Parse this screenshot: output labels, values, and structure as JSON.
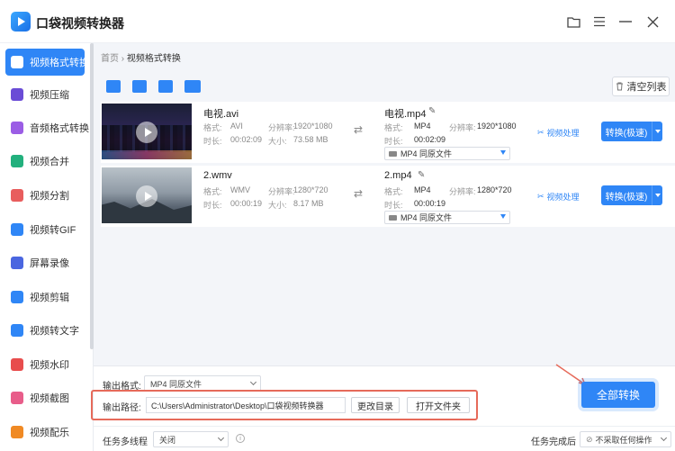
{
  "app": {
    "title": "口袋视频转换器"
  },
  "sidebar": {
    "items": [
      {
        "label": "视频格式转换",
        "color": "#ffffff"
      },
      {
        "label": "视频压缩",
        "color": "#6a4cd6"
      },
      {
        "label": "音频格式转换",
        "color": "#9b5de5"
      },
      {
        "label": "视频合并",
        "color": "#22b07d"
      },
      {
        "label": "视频分割",
        "color": "#e85d5d"
      },
      {
        "label": "视频转GIF",
        "color": "#2f86f6"
      },
      {
        "label": "屏幕录像",
        "color": "#4a66e0"
      },
      {
        "label": "视频剪辑",
        "color": "#2f86f6"
      },
      {
        "label": "视频转文字",
        "color": "#2f86f6"
      },
      {
        "label": "视频水印",
        "color": "#e84d4d"
      },
      {
        "label": "视频截图",
        "color": "#e85d8a"
      },
      {
        "label": "视频配乐",
        "color": "#f08a24"
      }
    ]
  },
  "breadcrumb": {
    "home": "首页",
    "sep": "›",
    "current": "视频格式转换"
  },
  "toolbar": {
    "clear_label": "清空列表"
  },
  "files": [
    {
      "src_name": "电视.avi",
      "fmt_label": "格式:",
      "src_fmt": "AVI",
      "res_label": "分辨率:",
      "src_res": "1920*1080",
      "dur_label": "时长:",
      "src_dur": "00:02:09",
      "size_label": "大小:",
      "src_size": "73.58 MB",
      "out_name": "电视.mp4",
      "out_fmt": "MP4",
      "out_res": "1920*1080",
      "out_dur": "00:02:09",
      "out_select": "MP4  同原文件",
      "proc_label": "视频处理",
      "conv_label": "转换(极速)"
    },
    {
      "src_name": "2.wmv",
      "fmt_label": "格式:",
      "src_fmt": "WMV",
      "res_label": "分辨率:",
      "src_res": "1280*720",
      "dur_label": "时长:",
      "src_dur": "00:00:19",
      "size_label": "大小:",
      "src_size": "8.17 MB",
      "out_name": "2.mp4",
      "out_fmt": "MP4",
      "out_res": "1280*720",
      "out_dur": "00:00:19",
      "out_select": "MP4  同原文件",
      "proc_label": "视频处理",
      "conv_label": "转换(极速)"
    }
  ],
  "bottom": {
    "out_format_label": "输出格式:",
    "out_format_value": "MP4  同原文件",
    "out_path_label": "输出路径:",
    "out_path_value": "C:\\Users\\Administrator\\Desktop\\口袋视频转换器",
    "change_dir_label": "更改目录",
    "open_folder_label": "打开文件夹",
    "convert_all_label": "全部转换",
    "thread_label": "任务多线程",
    "thread_value": "关闭",
    "after_label": "任务完成后",
    "after_value": "不采取任何操作"
  }
}
